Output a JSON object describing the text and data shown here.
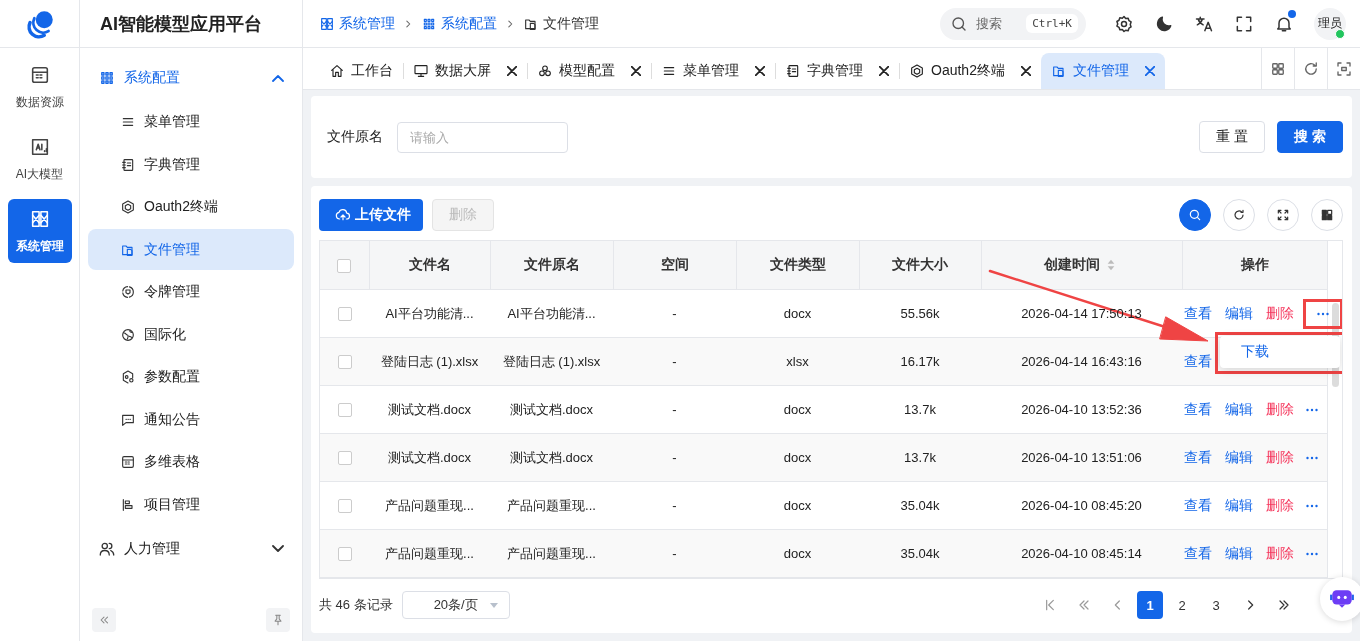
{
  "app_title": "AI智能模型应用平台",
  "rail": [
    {
      "label": "数据资源",
      "selected": false
    },
    {
      "label": "AI大模型",
      "selected": false
    },
    {
      "label": "系统管理",
      "selected": true
    }
  ],
  "sidebar": {
    "groups": [
      {
        "label": "系统配置",
        "expanded": true,
        "children": [
          {
            "label": "菜单管理",
            "selected": false
          },
          {
            "label": "字典管理",
            "selected": false
          },
          {
            "label": "Oauth2终端",
            "selected": false
          },
          {
            "label": "文件管理",
            "selected": true
          },
          {
            "label": "令牌管理",
            "selected": false
          },
          {
            "label": "国际化",
            "selected": false
          },
          {
            "label": "参数配置",
            "selected": false
          },
          {
            "label": "通知公告",
            "selected": false
          },
          {
            "label": "多维表格",
            "selected": false
          },
          {
            "label": "项目管理",
            "selected": false
          }
        ]
      },
      {
        "label": "人力管理",
        "expanded": false
      }
    ]
  },
  "breadcrumb": [
    "系统管理",
    "系统配置",
    "文件管理"
  ],
  "search": {
    "placeholder": "搜索",
    "shortcut": "Ctrl+K"
  },
  "notifications_unread": true,
  "user": {
    "name": "理员",
    "online": true
  },
  "tabs": [
    {
      "label": "工作台",
      "closable": false,
      "selected": false
    },
    {
      "label": "数据大屏",
      "closable": true,
      "selected": false
    },
    {
      "label": "模型配置",
      "closable": true,
      "selected": false
    },
    {
      "label": "菜单管理",
      "closable": true,
      "selected": false
    },
    {
      "label": "字典管理",
      "closable": true,
      "selected": false
    },
    {
      "label": "Oauth2终端",
      "closable": true,
      "selected": false
    },
    {
      "label": "文件管理",
      "closable": true,
      "selected": true
    }
  ],
  "filter": {
    "label": "文件原名",
    "placeholder": "请输入",
    "reset": "重 置",
    "submit": "搜 索"
  },
  "toolbar": {
    "upload": "上传文件",
    "delete": {
      "label": "删除",
      "disabled": true
    }
  },
  "table": {
    "all_checked": false,
    "columns": [
      {
        "label": "文件名",
        "sortable": false
      },
      {
        "label": "文件原名",
        "sortable": false
      },
      {
        "label": "空间",
        "sortable": false
      },
      {
        "label": "文件类型",
        "sortable": false
      },
      {
        "label": "文件大小",
        "sortable": false
      },
      {
        "label": "创建时间",
        "sortable": true
      },
      {
        "label": "操作",
        "sortable": false
      }
    ],
    "rows": [
      {
        "cells": [
          "AI平台功能清...",
          "AI平台功能清...",
          "-",
          "docx",
          "55.56k",
          "2026-04-14 17:50:13"
        ],
        "checked": false,
        "actions": [
          {
            "label": "查看",
            "kind": "link"
          },
          {
            "label": "编辑",
            "kind": "link"
          },
          {
            "label": "删除",
            "kind": "danger"
          }
        ],
        "more": true,
        "more_highlighted": true
      },
      {
        "cells": [
          "登陆日志 (1).xlsx",
          "登陆日志 (1).xlsx",
          "-",
          "xlsx",
          "16.17k",
          "2026-04-14 16:43:16"
        ],
        "checked": false,
        "actions": [
          {
            "label": "查看",
            "kind": "link"
          }
        ],
        "more": false
      },
      {
        "cells": [
          "测试文档.docx",
          "测试文档.docx",
          "-",
          "docx",
          "13.7k",
          "2026-04-10 13:52:36"
        ],
        "checked": false,
        "actions": [
          {
            "label": "查看",
            "kind": "link"
          },
          {
            "label": "编辑",
            "kind": "link"
          },
          {
            "label": "删除",
            "kind": "danger"
          }
        ],
        "more": true,
        "more_highlighted": false
      },
      {
        "cells": [
          "测试文档.docx",
          "测试文档.docx",
          "-",
          "docx",
          "13.7k",
          "2026-04-10 13:51:06"
        ],
        "checked": false,
        "actions": [
          {
            "label": "查看",
            "kind": "link"
          },
          {
            "label": "编辑",
            "kind": "link"
          },
          {
            "label": "删除",
            "kind": "danger"
          }
        ],
        "more": true,
        "more_highlighted": false
      },
      {
        "cells": [
          "产品问题重现...",
          "产品问题重现...",
          "-",
          "docx",
          "35.04k",
          "2026-04-10 08:45:20"
        ],
        "checked": false,
        "actions": [
          {
            "label": "查看",
            "kind": "link"
          },
          {
            "label": "编辑",
            "kind": "link"
          },
          {
            "label": "删除",
            "kind": "danger"
          }
        ],
        "more": true,
        "more_highlighted": false
      },
      {
        "cells": [
          "产品问题重现...",
          "产品问题重现...",
          "-",
          "docx",
          "35.04k",
          "2026-04-10 08:45:14"
        ],
        "checked": false,
        "actions": [
          {
            "label": "查看",
            "kind": "link"
          },
          {
            "label": "编辑",
            "kind": "link"
          },
          {
            "label": "删除",
            "kind": "danger"
          }
        ],
        "more": true,
        "more_highlighted": false
      }
    ],
    "dropdown": {
      "items": [
        "下载"
      ],
      "highlighted": true
    }
  },
  "pager": {
    "total": "共 46 条记录",
    "page_size": "20条/页",
    "pages": [
      {
        "label": "1",
        "selected": true
      },
      {
        "label": "2",
        "selected": false
      },
      {
        "label": "3",
        "selected": false
      }
    ]
  }
}
